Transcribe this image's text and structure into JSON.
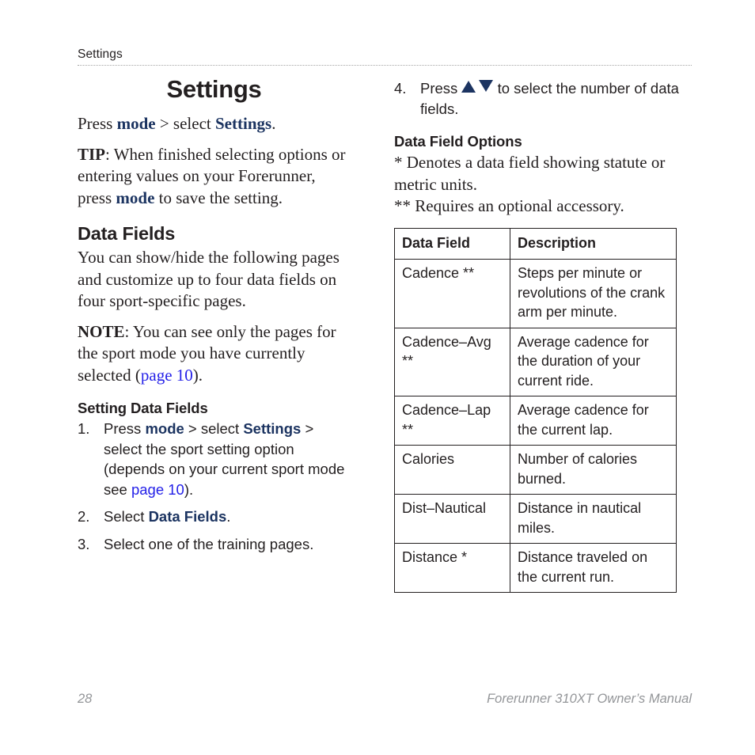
{
  "header": {
    "running_title": "Settings"
  },
  "page_title": "Settings",
  "left_column": {
    "intro": {
      "press_label": "Press ",
      "mode_label": "mode",
      "gt_label": " > select ",
      "settings_label": "Settings",
      "period": "."
    },
    "tip": {
      "label": "TIP",
      "text": ": When finished selecting options or entering values on your Forerunner, press ",
      "mode_label": "mode",
      "text_after": " to save the setting."
    },
    "data_fields_heading": "Data Fields",
    "data_fields_para": "You can show/hide the following pages and customize up to four data fields on four sport-specific pages.",
    "note": {
      "label": "NOTE",
      "text": ": You can see only the pages for the sport mode you have currently selected (",
      "link": "page 10",
      "text_after": ")."
    },
    "setting_data_fields_heading": "Setting Data Fields",
    "steps": [
      {
        "num": "1.",
        "parts": [
          {
            "t": "Press ",
            "s": "plain"
          },
          {
            "t": "mode",
            "s": "navbold"
          },
          {
            "t": " > select ",
            "s": "plain"
          },
          {
            "t": "Settings",
            "s": "navbold"
          },
          {
            "t": " > select the sport setting option (depends on your current sport mode see ",
            "s": "plain"
          },
          {
            "t": "page 10",
            "s": "xref"
          },
          {
            "t": ").",
            "s": "plain"
          }
        ]
      },
      {
        "num": "2.",
        "parts": [
          {
            "t": "Select ",
            "s": "plain"
          },
          {
            "t": "Data Fields",
            "s": "navbold"
          },
          {
            "t": ".",
            "s": "plain"
          }
        ]
      },
      {
        "num": "3.",
        "parts": [
          {
            "t": "Select one of the training pages.",
            "s": "plain"
          }
        ]
      }
    ]
  },
  "right_column": {
    "step4": {
      "num": "4.",
      "text_before": "Press ",
      "icon_up": "triangle-up",
      "icon_down": "triangle-down",
      "text_after": " to select the number of data fields."
    },
    "data_field_options_heading": "Data Field Options",
    "legend_single": "* Denotes a data field showing statute or metric units.",
    "legend_double": "** Requires an optional accessory.",
    "table": {
      "columns": [
        "Data Field",
        "Description"
      ],
      "rows": [
        [
          "Cadence **",
          "Steps per minute or revolutions of the crank arm per minute."
        ],
        [
          "Cadence–Avg **",
          "Average cadence for the duration of your current ride."
        ],
        [
          "Cadence–Lap **",
          "Average cadence for the current lap."
        ],
        [
          "Calories",
          "Number of calories burned."
        ],
        [
          "Dist–Nautical",
          "Distance in nautical miles."
        ],
        [
          "Distance *",
          "Distance traveled on the current run."
        ]
      ]
    }
  },
  "footer": {
    "page_number": "28",
    "manual_title": "Forerunner 310XT Owner’s Manual"
  },
  "colors": {
    "nav_blue": "#1c3461",
    "xref_blue": "#2420e8",
    "text": "#231f20",
    "footer_gray": "#939598",
    "rule_gray": "#a6a6a6"
  }
}
